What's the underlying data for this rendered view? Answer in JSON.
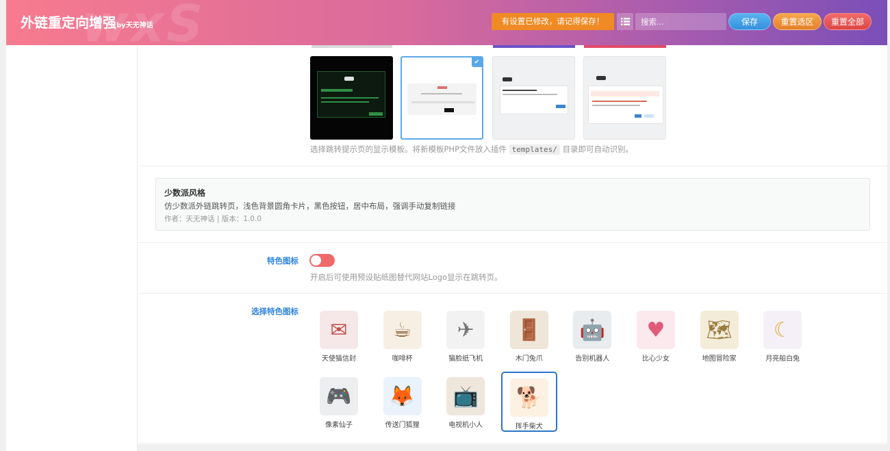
{
  "header": {
    "watermark": "wxS",
    "title": "外链重定向增强",
    "title_suffix": "by天无神话",
    "notice": "有设置已修改，请记得保存！",
    "search_placeholder": "搜索...",
    "save_label": "保存",
    "reset_section_label": "重置选区",
    "reset_all_label": "重置全部",
    "list_icon": "list-icon"
  },
  "templates": {
    "selected_index": 1,
    "description_before": "选择跳转提示页的显示模板。将新模板PHP文件放入插件",
    "description_code": "templates/",
    "description_after": "目录即可自动识别。"
  },
  "template_info": {
    "name": "少数派风格",
    "description": "仿少数派外链跳转页，浅色背景圆角卡片，黑色按钮，居中布局，强调手动复制链接",
    "meta": "作者：天无神话 | 版本：1.0.0"
  },
  "feature_icon": {
    "label": "特色图标",
    "enabled": false,
    "description": "开启后可使用预设贴纸图替代网站Logo显示在跳转页。"
  },
  "icon_select": {
    "label": "选择特色图标",
    "selected_index": 11,
    "items": [
      {
        "label": "天使猫信封",
        "icon": "angel-cat-envelope-icon",
        "bg": "#f6e8e8",
        "glyph": "✉",
        "color": "#c0504d"
      },
      {
        "label": "咖啡杯",
        "icon": "coffee-cup-icon",
        "bg": "#f7efe4",
        "glyph": "☕",
        "color": "#8b5a2b"
      },
      {
        "label": "猫脸纸飞机",
        "icon": "paper-plane-icon",
        "bg": "#f2f2f2",
        "glyph": "✈",
        "color": "#777777"
      },
      {
        "label": "木门兔爪",
        "icon": "wooden-door-icon",
        "bg": "#efe5d8",
        "glyph": "🚪",
        "color": "#8a5a33"
      },
      {
        "label": "告别机器人",
        "icon": "robot-icon",
        "bg": "#e9ecef",
        "glyph": "🤖",
        "color": "#444444"
      },
      {
        "label": "比心少女",
        "icon": "heart-girl-icon",
        "bg": "#fbe9ee",
        "glyph": "♥",
        "color": "#e05a7a"
      },
      {
        "label": "地图冒险家",
        "icon": "map-explorer-icon",
        "bg": "#f3ecd9",
        "glyph": "🗺",
        "color": "#9b7b3c"
      },
      {
        "label": "月亮船白兔",
        "icon": "moon-rabbit-icon",
        "bg": "#f5f0f8",
        "glyph": "☾",
        "color": "#e0b03c"
      },
      {
        "label": "像素仙子",
        "icon": "game-controller-icon",
        "bg": "#eceef0",
        "glyph": "🎮",
        "color": "#555555"
      },
      {
        "label": "传送门狐狸",
        "icon": "portal-fox-icon",
        "bg": "#eaf2fb",
        "glyph": "🦊",
        "color": "#e07a30"
      },
      {
        "label": "电视机小人",
        "icon": "tv-icon",
        "bg": "#efe6dc",
        "glyph": "📺",
        "color": "#6b4a33"
      },
      {
        "label": "挥手柴犬",
        "icon": "waving-shiba-icon",
        "bg": "#fdf1e3",
        "glyph": "🐕",
        "color": "#e39040"
      }
    ]
  },
  "colors": {
    "accent_blue": "#2c83dc",
    "toggle_off": "#ef6b6b",
    "notice_orange": "#f08a24"
  }
}
